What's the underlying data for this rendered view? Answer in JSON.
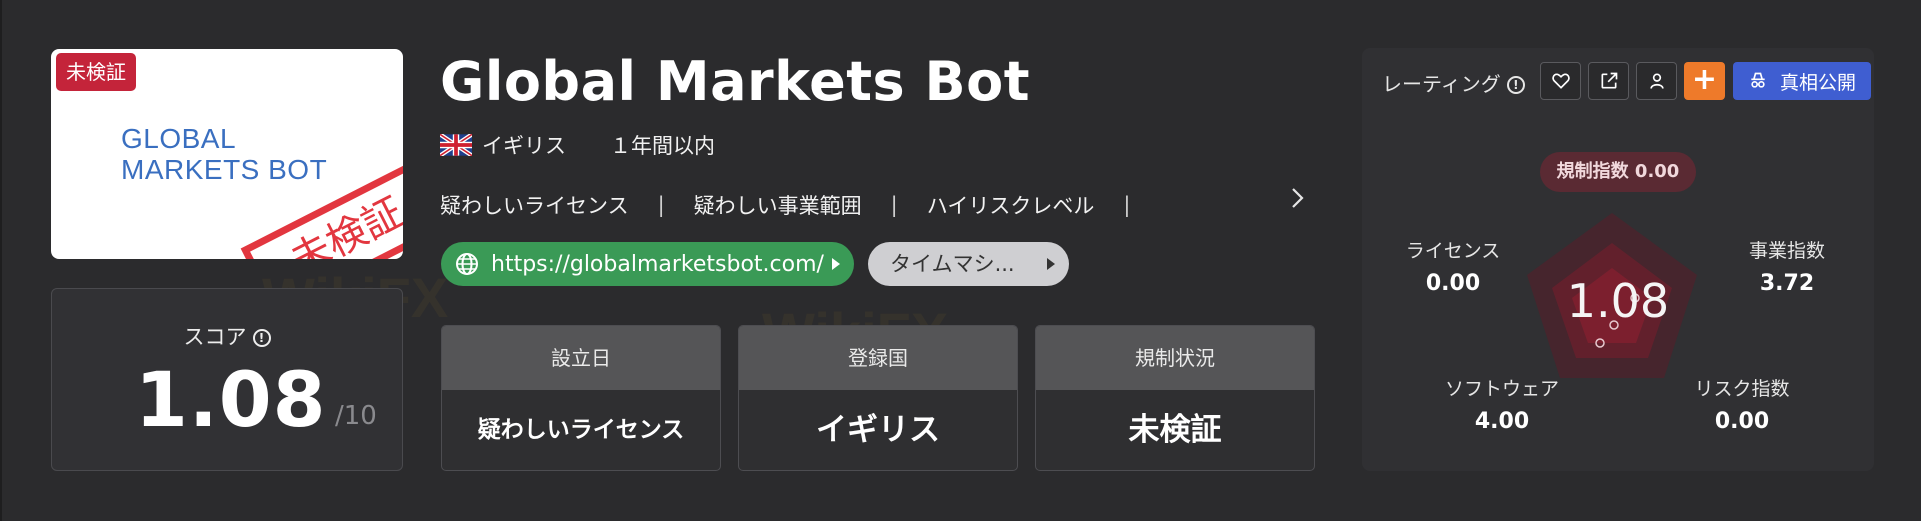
{
  "logo": {
    "badge": "未検証",
    "text_line1": "GLOBAL",
    "text_line2": "MARKETS BOT",
    "stamp": "未検証"
  },
  "score": {
    "label": "スコア",
    "value": "1.08",
    "max": "/10"
  },
  "broker": {
    "name": "Global Markets Bot",
    "country": "イギリス",
    "age": "１年間以内"
  },
  "tags": [
    "疑わしいライセンス",
    "疑わしい事業範囲",
    "ハイリスクレベル"
  ],
  "links": {
    "url": "https://globalmarketsbot.com/",
    "time_machine": "タイムマシ..."
  },
  "info_boxes": [
    {
      "label": "設立日",
      "value": "疑わしいライセンス"
    },
    {
      "label": "登録国",
      "value": "イギリス"
    },
    {
      "label": "規制状況",
      "value": "未検証"
    }
  ],
  "rating": {
    "label": "レーティング",
    "reveal_button": "真相公開",
    "plus_button": "+",
    "regulation_index": "規制指数 0.00",
    "center_score": "1.08",
    "metrics": {
      "license": {
        "label": "ライセンス",
        "value": "0.00"
      },
      "business": {
        "label": "事業指数",
        "value": "3.72"
      },
      "software": {
        "label": "ソフトウェア",
        "value": "4.00"
      },
      "risk": {
        "label": "リスク指数",
        "value": "0.00"
      }
    }
  },
  "colors": {
    "background": "#2b2b2d",
    "unverified_red": "#c4243a",
    "url_green": "#3a9a56",
    "plus_orange": "#ee7a2a",
    "reveal_blue": "#3f5ed1"
  },
  "icons": [
    "info-icon",
    "uk-flag-icon",
    "globe-icon",
    "heart-icon",
    "share-icon",
    "user-icon",
    "detective-icon",
    "chevron-right-icon"
  ]
}
